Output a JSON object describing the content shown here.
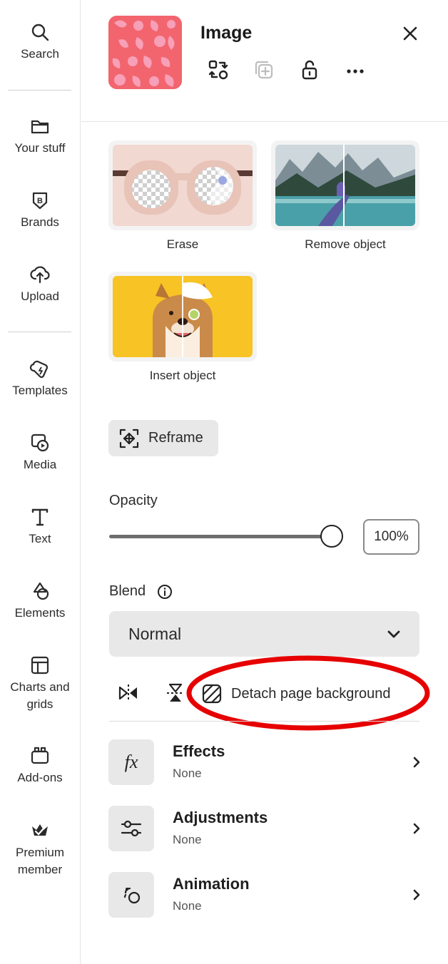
{
  "rail": {
    "items": [
      {
        "label": "Search",
        "icon": "search-icon"
      },
      {
        "label": "Your stuff",
        "icon": "folder-icon"
      },
      {
        "label": "Brands",
        "icon": "brand-icon"
      },
      {
        "label": "Upload",
        "icon": "upload-icon"
      },
      {
        "label": "Templates",
        "icon": "templates-icon"
      },
      {
        "label": "Media",
        "icon": "media-icon"
      },
      {
        "label": "Text",
        "icon": "text-icon"
      },
      {
        "label": "Elements",
        "icon": "elements-icon"
      },
      {
        "label": "Charts and grids",
        "icon": "charts-icon"
      },
      {
        "label": "Add-ons",
        "icon": "addons-icon"
      },
      {
        "label": "Premium member",
        "icon": "crown-icon"
      }
    ]
  },
  "panel": {
    "title": "Image",
    "header_icons": [
      "replace-icon",
      "duplicate-icon",
      "unlock-icon",
      "more-icon",
      "close-icon"
    ]
  },
  "features": {
    "erase": "Erase",
    "remove_object": "Remove object",
    "insert_object": "Insert object"
  },
  "reframe": {
    "label": "Reframe"
  },
  "opacity": {
    "label": "Opacity",
    "value_text": "100%",
    "value": 100
  },
  "blend": {
    "label": "Blend",
    "selected": "Normal"
  },
  "tools": {
    "detach_label": "Detach page background",
    "highlight_color": "#e60000"
  },
  "list": [
    {
      "title": "Effects",
      "sub": "None",
      "icon": "fx-icon"
    },
    {
      "title": "Adjustments",
      "sub": "None",
      "icon": "sliders-icon"
    },
    {
      "title": "Animation",
      "sub": "None",
      "icon": "animation-icon"
    }
  ]
}
